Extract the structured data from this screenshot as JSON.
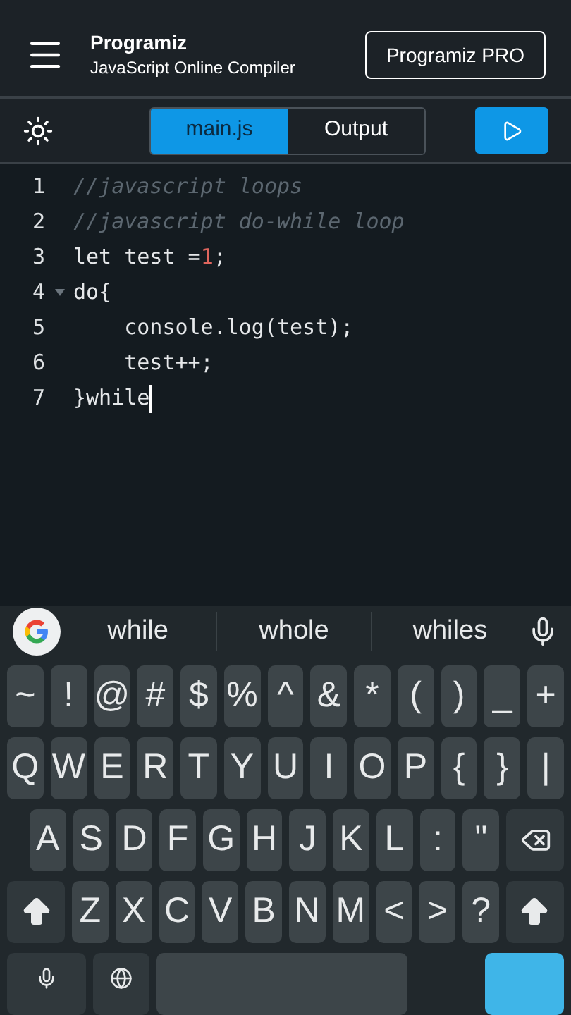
{
  "header": {
    "brand": "Programiz",
    "subtitle": "JavaScript Online Compiler",
    "pro_button": "Programiz PRO"
  },
  "tabs": [
    {
      "label": "main.js",
      "selected": true
    },
    {
      "label": "Output",
      "selected": false
    }
  ],
  "editor": {
    "lines": [
      {
        "number": "1",
        "foldable": false,
        "cursor": false,
        "segments": [
          {
            "kind": "comment",
            "text": "//javascript loops"
          }
        ]
      },
      {
        "number": "2",
        "foldable": false,
        "cursor": false,
        "segments": [
          {
            "kind": "comment",
            "text": "//javascript do-while loop"
          }
        ]
      },
      {
        "number": "3",
        "foldable": false,
        "cursor": false,
        "segments": [
          {
            "kind": "plain",
            "text": "let test ="
          },
          {
            "kind": "number",
            "text": "1"
          },
          {
            "kind": "plain",
            "text": ";"
          }
        ]
      },
      {
        "number": "4",
        "foldable": true,
        "cursor": false,
        "segments": [
          {
            "kind": "plain",
            "text": "do{"
          }
        ]
      },
      {
        "number": "5",
        "foldable": false,
        "cursor": false,
        "segments": [
          {
            "kind": "plain",
            "text": "    console.log(test);"
          }
        ]
      },
      {
        "number": "6",
        "foldable": false,
        "cursor": false,
        "segments": [
          {
            "kind": "plain",
            "text": "    test++;"
          }
        ]
      },
      {
        "number": "7",
        "foldable": false,
        "cursor": true,
        "segments": [
          {
            "kind": "plain",
            "text": "}while"
          }
        ]
      }
    ]
  },
  "suggestions": [
    "while",
    "whole",
    "whiles"
  ],
  "keyboard": {
    "rows": [
      [
        {
          "kind": "char",
          "label": "~"
        },
        {
          "kind": "char",
          "label": "!"
        },
        {
          "kind": "char",
          "label": "@"
        },
        {
          "kind": "char",
          "label": "#"
        },
        {
          "kind": "char",
          "label": "$"
        },
        {
          "kind": "char",
          "label": "%"
        },
        {
          "kind": "char",
          "label": "^"
        },
        {
          "kind": "char",
          "label": "&"
        },
        {
          "kind": "char",
          "label": "*"
        },
        {
          "kind": "char",
          "label": "("
        },
        {
          "kind": "char",
          "label": ")"
        },
        {
          "kind": "char",
          "label": "_"
        },
        {
          "kind": "char",
          "label": "+"
        }
      ],
      [
        {
          "kind": "char",
          "label": "Q"
        },
        {
          "kind": "char",
          "label": "W"
        },
        {
          "kind": "char",
          "label": "E"
        },
        {
          "kind": "char",
          "label": "R"
        },
        {
          "kind": "char",
          "label": "T"
        },
        {
          "kind": "char",
          "label": "Y"
        },
        {
          "kind": "char",
          "label": "U"
        },
        {
          "kind": "char",
          "label": "I"
        },
        {
          "kind": "char",
          "label": "O"
        },
        {
          "kind": "char",
          "label": "P"
        },
        {
          "kind": "char",
          "label": "{"
        },
        {
          "kind": "char",
          "label": "}"
        },
        {
          "kind": "char",
          "label": "|"
        }
      ],
      [
        {
          "kind": "char",
          "label": "A"
        },
        {
          "kind": "char",
          "label": "S"
        },
        {
          "kind": "char",
          "label": "D"
        },
        {
          "kind": "char",
          "label": "F"
        },
        {
          "kind": "char",
          "label": "G"
        },
        {
          "kind": "char",
          "label": "H"
        },
        {
          "kind": "char",
          "label": "J"
        },
        {
          "kind": "char",
          "label": "K"
        },
        {
          "kind": "char",
          "label": "L"
        },
        {
          "kind": "char",
          "label": ":"
        },
        {
          "kind": "char",
          "label": "\""
        },
        {
          "kind": "backspace"
        }
      ],
      [
        {
          "kind": "shift"
        },
        {
          "kind": "char",
          "label": "Z"
        },
        {
          "kind": "char",
          "label": "X"
        },
        {
          "kind": "char",
          "label": "C"
        },
        {
          "kind": "char",
          "label": "V"
        },
        {
          "kind": "char",
          "label": "B"
        },
        {
          "kind": "char",
          "label": "N"
        },
        {
          "kind": "char",
          "label": "M"
        },
        {
          "kind": "char",
          "label": "<"
        },
        {
          "kind": "char",
          "label": ">"
        },
        {
          "kind": "char",
          "label": "?"
        },
        {
          "kind": "shift"
        }
      ],
      [
        {
          "kind": "mic"
        },
        {
          "kind": "globe"
        },
        {
          "kind": "space"
        },
        {
          "kind": "enter"
        }
      ]
    ]
  }
}
